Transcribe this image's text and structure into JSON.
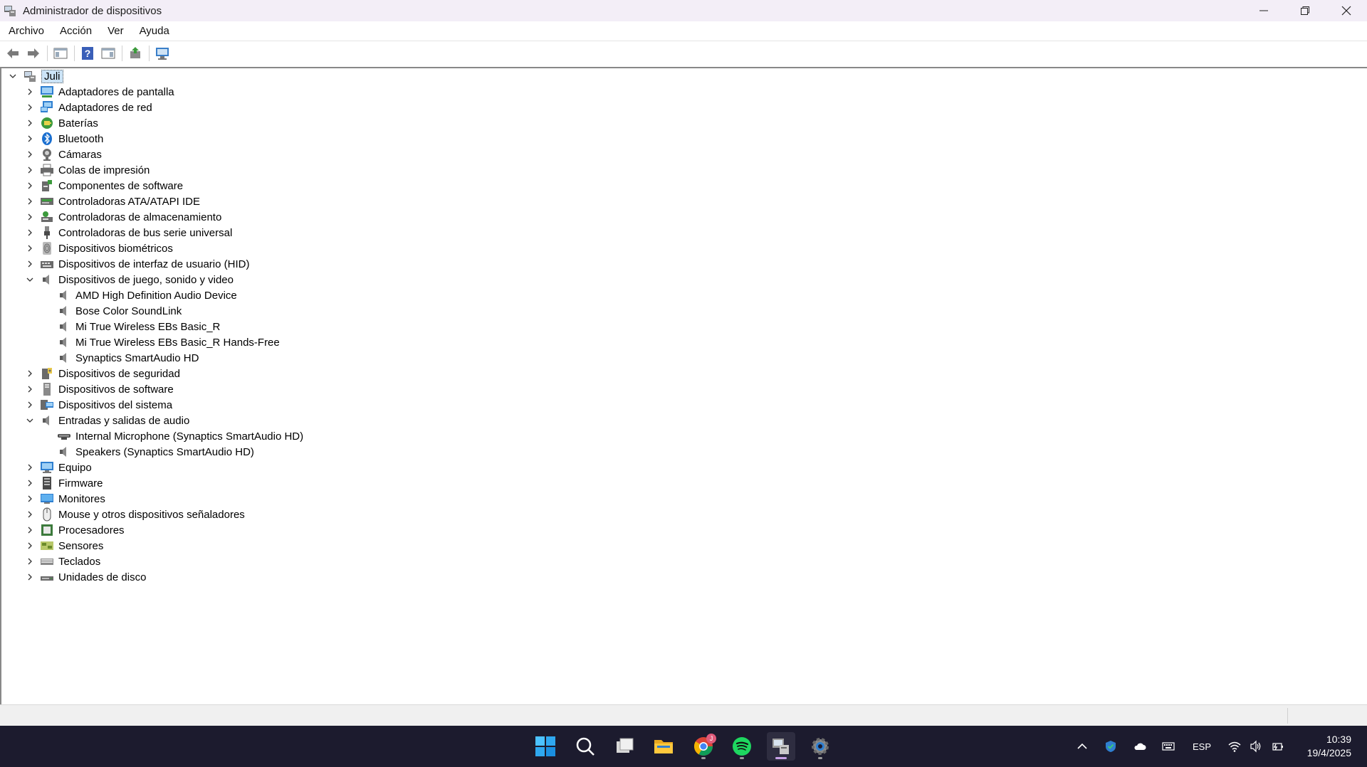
{
  "window": {
    "title": "Administrador de dispositivos"
  },
  "menu": [
    {
      "label": "Archivo"
    },
    {
      "label": "Acción"
    },
    {
      "label": "Ver"
    },
    {
      "label": "Ayuda"
    }
  ],
  "tree": {
    "root": "Juli",
    "items": [
      {
        "label": "Adaptadores de pantalla",
        "icon": "display-adapter-icon",
        "expanded": false
      },
      {
        "label": "Adaptadores de red",
        "icon": "network-adapter-icon",
        "expanded": false
      },
      {
        "label": "Baterías",
        "icon": "battery-icon",
        "expanded": false
      },
      {
        "label": "Bluetooth",
        "icon": "bluetooth-icon",
        "expanded": false
      },
      {
        "label": "Cámaras",
        "icon": "camera-icon",
        "expanded": false
      },
      {
        "label": "Colas de impresión",
        "icon": "printer-icon",
        "expanded": false
      },
      {
        "label": "Componentes de software",
        "icon": "software-component-icon",
        "expanded": false
      },
      {
        "label": "Controladoras ATA/ATAPI IDE",
        "icon": "ide-controller-icon",
        "expanded": false
      },
      {
        "label": "Controladoras de almacenamiento",
        "icon": "storage-controller-icon",
        "expanded": false
      },
      {
        "label": "Controladoras de bus serie universal",
        "icon": "usb-icon",
        "expanded": false
      },
      {
        "label": "Dispositivos biométricos",
        "icon": "biometric-icon",
        "expanded": false
      },
      {
        "label": "Dispositivos de interfaz de usuario (HID)",
        "icon": "hid-icon",
        "expanded": false
      },
      {
        "label": "Dispositivos de juego, sonido y video",
        "icon": "speaker-icon",
        "expanded": true,
        "children": [
          {
            "label": "AMD High Definition Audio Device",
            "icon": "speaker-icon"
          },
          {
            "label": "Bose Color SoundLink",
            "icon": "speaker-icon"
          },
          {
            "label": "Mi True Wireless EBs Basic_R",
            "icon": "speaker-icon"
          },
          {
            "label": "Mi True Wireless EBs Basic_R Hands-Free",
            "icon": "speaker-icon"
          },
          {
            "label": "Synaptics SmartAudio HD",
            "icon": "speaker-icon"
          }
        ]
      },
      {
        "label": "Dispositivos de seguridad",
        "icon": "security-device-icon",
        "expanded": false
      },
      {
        "label": "Dispositivos de software",
        "icon": "software-device-icon",
        "expanded": false
      },
      {
        "label": "Dispositivos del sistema",
        "icon": "system-device-icon",
        "expanded": false
      },
      {
        "label": "Entradas y salidas de audio",
        "icon": "speaker-icon",
        "expanded": true,
        "children": [
          {
            "label": "Internal Microphone (Synaptics SmartAudio HD)",
            "icon": "microphone-icon"
          },
          {
            "label": "Speakers (Synaptics SmartAudio HD)",
            "icon": "speaker-icon"
          }
        ]
      },
      {
        "label": "Equipo",
        "icon": "computer-icon",
        "expanded": false
      },
      {
        "label": "Firmware",
        "icon": "firmware-icon",
        "expanded": false
      },
      {
        "label": "Monitores",
        "icon": "monitor-icon",
        "expanded": false
      },
      {
        "label": "Mouse y otros dispositivos señaladores",
        "icon": "mouse-icon",
        "expanded": false
      },
      {
        "label": "Procesadores",
        "icon": "processor-icon",
        "expanded": false
      },
      {
        "label": "Sensores",
        "icon": "sensor-icon",
        "expanded": false
      },
      {
        "label": "Teclados",
        "icon": "keyboard-icon",
        "expanded": false
      },
      {
        "label": "Unidades de disco",
        "icon": "disk-drive-icon",
        "expanded": false
      }
    ]
  },
  "taskbar": {
    "apps": [
      {
        "name": "start-button",
        "icon": "windows-logo-icon"
      },
      {
        "name": "search-button",
        "icon": "search-icon"
      },
      {
        "name": "task-view-button",
        "icon": "task-view-icon"
      },
      {
        "name": "file-explorer-button",
        "icon": "folder-icon"
      },
      {
        "name": "chrome-button",
        "icon": "chrome-icon"
      },
      {
        "name": "spotify-button",
        "icon": "spotify-icon"
      },
      {
        "name": "device-manager-button",
        "icon": "device-manager-icon"
      },
      {
        "name": "settings-button",
        "icon": "gear-icon"
      }
    ],
    "language": "ESP",
    "time": "10:39",
    "date": "19/4/2025"
  },
  "colors": {
    "titlebar_bg": "#f3eef7",
    "taskbar_bg": "#1c1b2e",
    "selection_bg": "#cce4f7",
    "accent": "#0078d4"
  }
}
